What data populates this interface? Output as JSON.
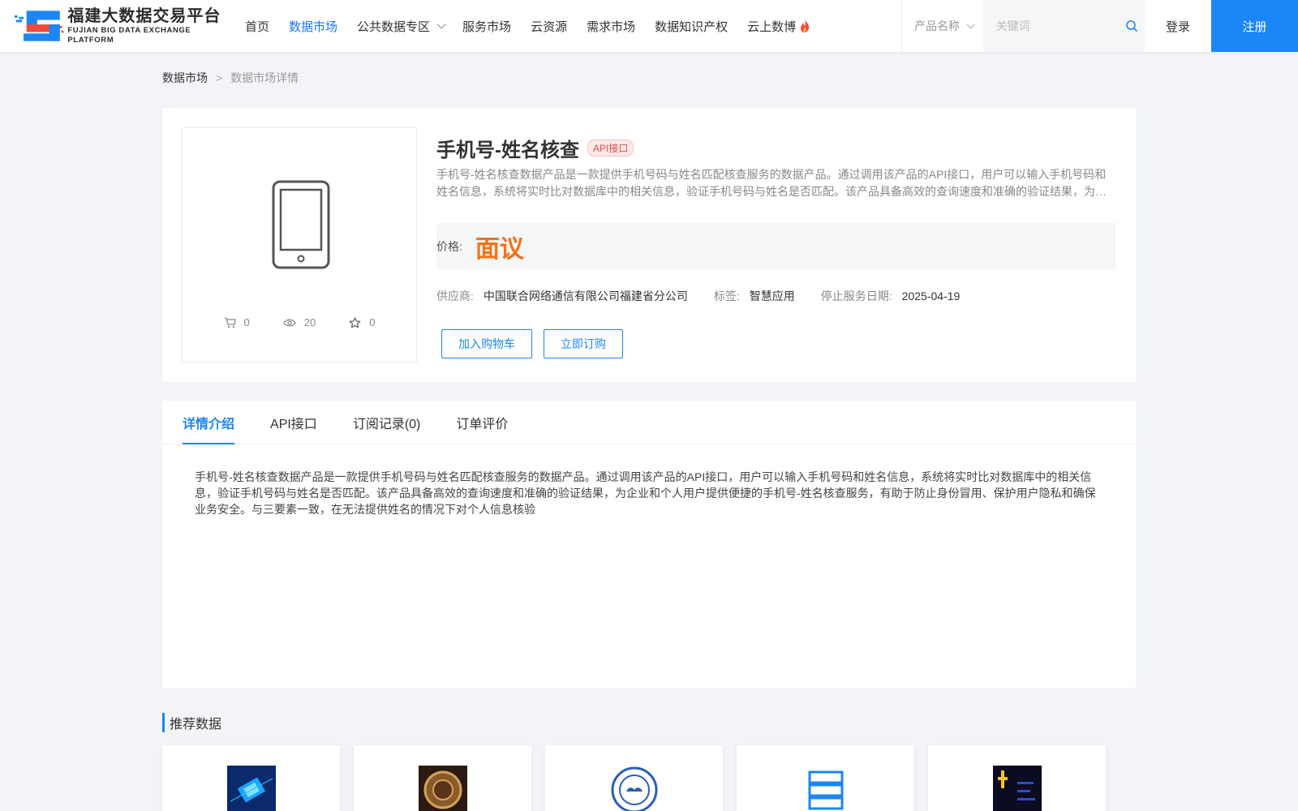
{
  "header": {
    "logo_cn": "福建大数据交易平台",
    "logo_en": "FUJIAN BIG DATA EXCHANGE  PLATFORM",
    "nav": [
      {
        "label": "首页",
        "active": false
      },
      {
        "label": "数据市场",
        "active": true
      },
      {
        "label": "公共数据专区",
        "active": false
      },
      {
        "label": "服务市场",
        "active": false
      },
      {
        "label": "云资源",
        "active": false
      },
      {
        "label": "需求市场",
        "active": false
      },
      {
        "label": "数据知识产权",
        "active": false
      },
      {
        "label": "云上数博",
        "active": false
      }
    ],
    "search_type": "产品名称",
    "search_placeholder": "关键词",
    "login_label": "登录",
    "register_label": "注册"
  },
  "breadcrumb": {
    "home": "数据市场",
    "separator": ">",
    "current": "数据市场详情"
  },
  "product": {
    "title": "手机号-姓名核查",
    "badge": "API接口",
    "description": "手机号-姓名核查数据产品是一款提供手机号码与姓名匹配核查服务的数据产品。通过调用该产品的API接口，用户可以输入手机号码和姓名信息，系统将实时比对数据库中的相关信息，验证手机号码与姓名是否匹配。该产品具备高效的查询速度和准确的验证结果，为企业和个人用户提供便捷的手机号-姓名核查服务，有助于防止身份冒用、保护用户隐私和确保业务安全。与三要素一致，在无法提供姓名的情况下对个人信息核验",
    "price_label": "价格:",
    "price_value": "面议",
    "supplier_label": "供应商:",
    "supplier": "中国联合网络通信有限公司福建省分公司",
    "tag_label": "标签:",
    "tag": "智慧应用",
    "stop_label": "停止服务日期:",
    "stop_date": "2025-04-19",
    "stats": {
      "cart": "0",
      "views": "20",
      "favorites": "0"
    },
    "add_cart_label": "加入购物车",
    "subscribe_label": "立即订购"
  },
  "detail": {
    "tabs": [
      {
        "label": "详情介绍",
        "active": true
      },
      {
        "label": "API接口",
        "active": false
      },
      {
        "label": "订阅记录(0)",
        "active": false
      },
      {
        "label": "订单评价",
        "active": false
      }
    ],
    "body": "手机号-姓名核查数据产品是一款提供手机号码与姓名匹配核查服务的数据产品。通过调用该产品的API接口，用户可以输入手机号码和姓名信息，系统将实时比对数据库中的相关信息，验证手机号码与姓名是否匹配。该产品具备高效的查询速度和准确的验证结果，为企业和个人用户提供便捷的手机号-姓名核查服务，有助于防止身份冒用、保护用户隐私和确保业务安全。与三要素一致，在无法提供姓名的情况下对个人信息核验"
  },
  "recommend": {
    "title": "推荐数据",
    "cards": [
      {
        "icon": "chip-image-icon"
      },
      {
        "icon": "coin-image-icon"
      },
      {
        "icon": "weather-seal-icon"
      },
      {
        "icon": "server-stack-icon"
      },
      {
        "icon": "dark-chart-image-icon"
      }
    ]
  },
  "colors": {
    "accent": "#1b86f5",
    "price": "#f5711a",
    "badge": "#e04b4b"
  }
}
